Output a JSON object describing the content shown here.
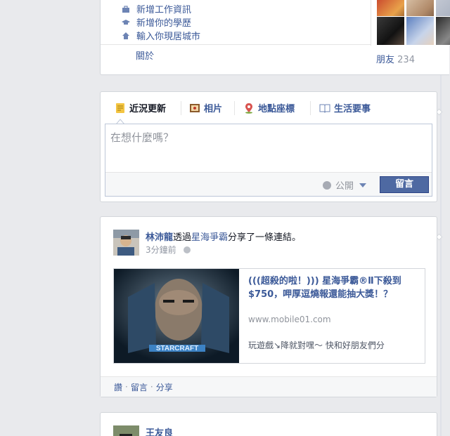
{
  "about": {
    "links": [
      {
        "label": "新增工作資訊",
        "icon": "briefcase-icon"
      },
      {
        "label": "新增你的學歷",
        "icon": "graduation-cap-icon"
      },
      {
        "label": "輸入你現居城市",
        "icon": "house-icon"
      }
    ],
    "more_label": "關於",
    "friends_label": "朋友",
    "friends_count": "234"
  },
  "composer": {
    "tabs": [
      {
        "label": "近況更新",
        "icon": "status-icon"
      },
      {
        "label": "相片",
        "icon": "photo-icon"
      },
      {
        "label": "地點座標",
        "icon": "map-pin-icon"
      },
      {
        "label": "生活要事",
        "icon": "life-event-icon"
      }
    ],
    "placeholder": "在想什麼嗎？",
    "privacy_label": "公開",
    "post_label": "留言"
  },
  "story": {
    "author": "林沛龍",
    "via_text": "透過",
    "source": "星海爭霸",
    "action_text": "分享了一條連結。",
    "time": "3分鐘前",
    "link": {
      "title": "(((超殺的啦！))) 星海爭霸®Ⅱ下殺到$750，呷厚逗燒報還能抽大獎！？",
      "url": "www.mobile01.com",
      "description": "玩遊戲↘降就對嘿～ 快和好朋友們分"
    },
    "actions": [
      "讚",
      "留言",
      "分享"
    ]
  },
  "story2": {
    "author": "王友良"
  },
  "colors": {
    "link": "#3b5998",
    "post_button": "#4e69a2",
    "background": "#e9eaed"
  }
}
